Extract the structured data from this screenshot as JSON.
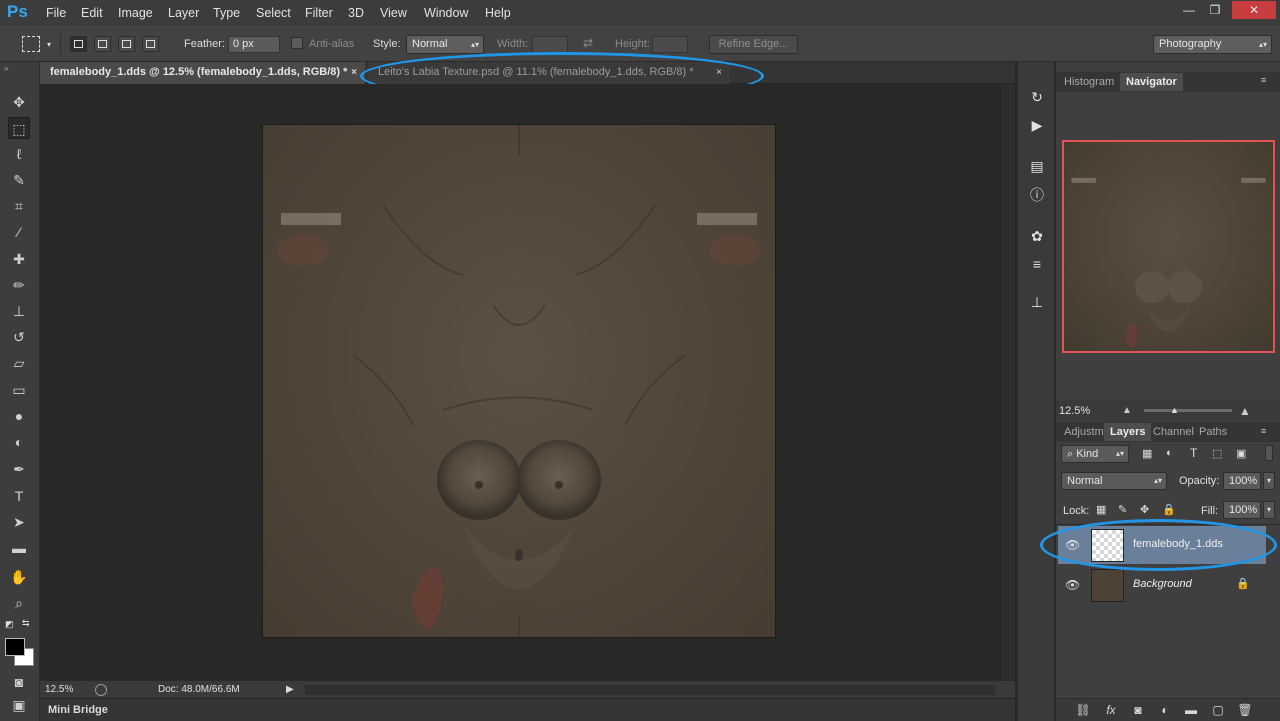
{
  "app": {
    "logo": "Ps"
  },
  "menu": [
    "File",
    "Edit",
    "Image",
    "Layer",
    "Type",
    "Select",
    "Filter",
    "3D",
    "View",
    "Window",
    "Help"
  ],
  "window_controls": {
    "minimize": "—",
    "restore": "❐",
    "close": "✕"
  },
  "options": {
    "feather_label": "Feather:",
    "feather_value": "0 px",
    "antialias_label": "Anti-alias",
    "style_label": "Style:",
    "style_value": "Normal",
    "width_label": "Width:",
    "height_label": "Height:",
    "refine_edge": "Refine Edge...",
    "workspace": "Photography"
  },
  "tabs": [
    {
      "label": "femalebody_1.dds @ 12.5% (femalebody_1.dds, RGB/8) *",
      "active": true
    },
    {
      "label": "Leito's Labia Texture.psd @ 11.1% (femalebody_1.dds, RGB/8) *",
      "active": false
    }
  ],
  "tab_close": "×",
  "status": {
    "zoom": "12.5%",
    "doc": "Doc: 48.0M/66.6M"
  },
  "minibridge": "Mini Bridge",
  "panels": {
    "top_tabs": [
      "Histogram",
      "Navigator"
    ],
    "nav_zoom": "12.5%",
    "layer_tabs": [
      "Adjustm",
      "Layers",
      "Channel",
      "Paths"
    ],
    "kind_label": "Kind",
    "blend_mode": "Normal",
    "opacity_label": "Opacity:",
    "opacity_value": "100%",
    "lock_label": "Lock:",
    "fill_label": "Fill:",
    "fill_value": "100%",
    "layers": [
      {
        "name": "femalebody_1.dds",
        "selected": true,
        "italic": false
      },
      {
        "name": "Background",
        "selected": false,
        "italic": true
      }
    ]
  },
  "colors": {
    "accent": "#2196e6",
    "nav_frame": "#e25353",
    "selected_layer": "#6a7f99"
  }
}
